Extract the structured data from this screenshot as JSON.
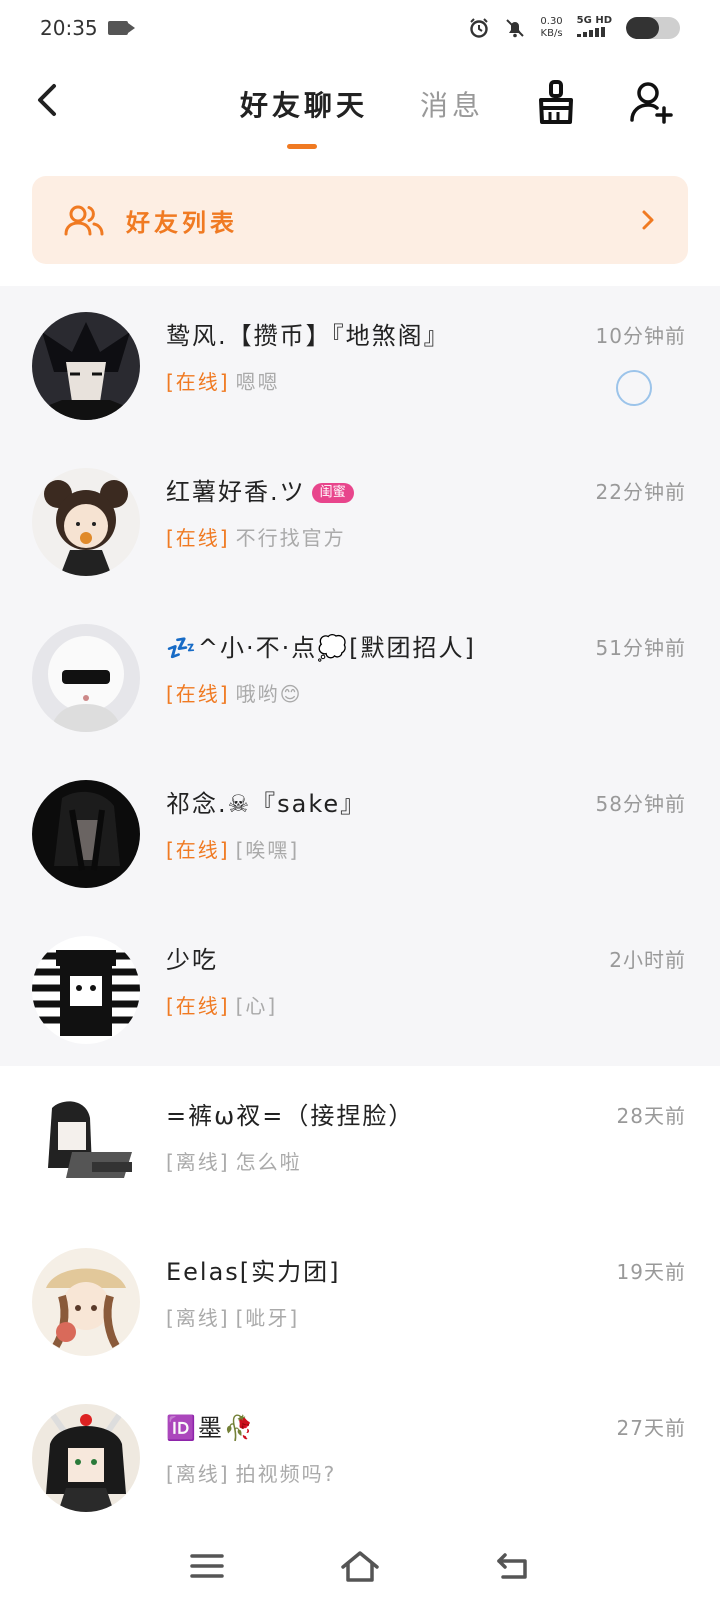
{
  "status_bar": {
    "time": "20:35",
    "net_speed_value": "0.30",
    "net_speed_unit": "KB/s",
    "network": "5G HD",
    "battery_level": 0.62
  },
  "header": {
    "tabs": [
      {
        "label": "好友聊天",
        "active": true
      },
      {
        "label": "消息",
        "active": false
      }
    ],
    "accent_color": "#f07a22"
  },
  "friend_list_banner": {
    "label": "好友列表"
  },
  "chats": [
    {
      "name": "鸷风.【攒币】『地煞阁』",
      "time": "10分钟前",
      "status": "[在线]",
      "preview": "嗯嗯",
      "online": true,
      "avatar": "dark-anime-boy"
    },
    {
      "name": "红薯好香.ツ",
      "badge": "闺蜜",
      "time": "22分钟前",
      "status": "[在线]",
      "preview": "不行找官方",
      "online": true,
      "avatar": "chibi-girl"
    },
    {
      "name": "💤^小·不·点💭[默团招人]",
      "time": "51分钟前",
      "status": "[在线]",
      "preview": "哦哟😊",
      "online": true,
      "avatar": "white-hair-girl"
    },
    {
      "name": "祁念.☠『sake』",
      "time": "58分钟前",
      "status": "[在线]",
      "preview": "[唉嘿]",
      "online": true,
      "avatar": "dark-portrait"
    },
    {
      "name": "少吃",
      "time": "2小时前",
      "status": "[在线]",
      "preview": "[心]",
      "online": true,
      "avatar": "genius-girl"
    },
    {
      "name": "=裤ω衩=（接捏脸）",
      "time": "28天前",
      "status": "[离线]",
      "preview": "怎么啦",
      "online": false,
      "avatar": "sketch-girl"
    },
    {
      "name": "Eelas[实力团]",
      "time": "19天前",
      "status": "[离线]",
      "preview": "[呲牙]",
      "online": false,
      "avatar": "hat-girl"
    },
    {
      "name": "🆔墨🥀",
      "time": "27天前",
      "status": "[离线]",
      "preview": "拍视频吗?",
      "online": false,
      "avatar": "horned-boy"
    }
  ]
}
